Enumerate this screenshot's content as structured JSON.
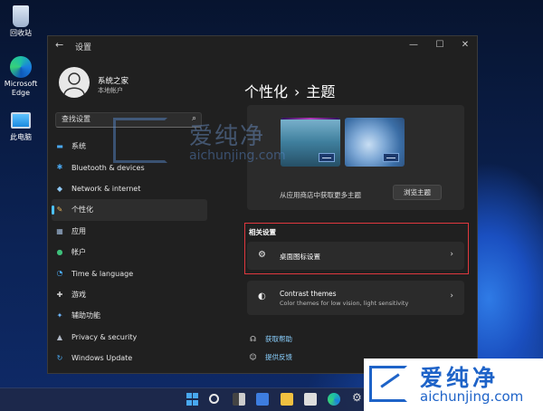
{
  "desktop": {
    "icons": [
      {
        "label": "回收站"
      },
      {
        "label": "Microsoft Edge"
      },
      {
        "label": "此电脑"
      }
    ]
  },
  "window": {
    "title": "设置",
    "controls": {
      "minimize": "—",
      "maximize": "☐",
      "close": "✕"
    }
  },
  "user": {
    "name": "系统之家",
    "account": "本地帐户"
  },
  "search": {
    "placeholder": "查找设置"
  },
  "nav": {
    "items": [
      {
        "label": "系统",
        "icon": "monitor-icon",
        "glyph": "▬",
        "color": "#4aa8f0"
      },
      {
        "label": "Bluetooth & devices",
        "icon": "bluetooth-icon",
        "glyph": "✱",
        "color": "#4aa8f0"
      },
      {
        "label": "Network & internet",
        "icon": "wifi-icon",
        "glyph": "◆",
        "color": "#8fc9f5"
      },
      {
        "label": "个性化",
        "icon": "brush-icon",
        "glyph": "✎",
        "color": "#e8b45a"
      },
      {
        "label": "应用",
        "icon": "apps-icon",
        "glyph": "▦",
        "color": "#9db6d6"
      },
      {
        "label": "帐户",
        "icon": "account-icon",
        "glyph": "●",
        "color": "#3ec07a"
      },
      {
        "label": "Time & language",
        "icon": "globe-clock-icon",
        "glyph": "◔",
        "color": "#4aa8f0"
      },
      {
        "label": "游戏",
        "icon": "gamepad-icon",
        "glyph": "✚",
        "color": "#cfcfcf"
      },
      {
        "label": "辅助功能",
        "icon": "accessibility-icon",
        "glyph": "✦",
        "color": "#6fb8ff"
      },
      {
        "label": "Privacy & security",
        "icon": "shield-icon",
        "glyph": "▲",
        "color": "#b0b8c4"
      },
      {
        "label": "Windows Update",
        "icon": "update-icon",
        "glyph": "↻",
        "color": "#4aa8f0"
      }
    ],
    "active_index": 3
  },
  "main": {
    "breadcrumb": {
      "parent": "个性化",
      "separator": "›",
      "current": "主题"
    },
    "themes": {
      "store_text": "从应用商店中获取更多主题",
      "browse_button": "浏览主题"
    },
    "related_label": "相关设置",
    "desktop_icon_settings": {
      "title": "桌面图标设置",
      "icon": "desktop-settings-icon"
    },
    "contrast_themes": {
      "title": "Contrast themes",
      "subtitle": "Color themes for low vision, light sensitivity",
      "icon": "contrast-icon"
    },
    "links": {
      "help": "获取帮助",
      "feedback": "提供反馈"
    }
  },
  "watermark": {
    "text_cn": "爱纯净",
    "url": "aichunjing.com"
  },
  "brand": {
    "text_cn": "爱纯净",
    "url": "aichunjing.com"
  },
  "colors": {
    "accent": "#4cc2ff",
    "highlight_border": "#e0383e",
    "link": "#8ad0ff"
  }
}
